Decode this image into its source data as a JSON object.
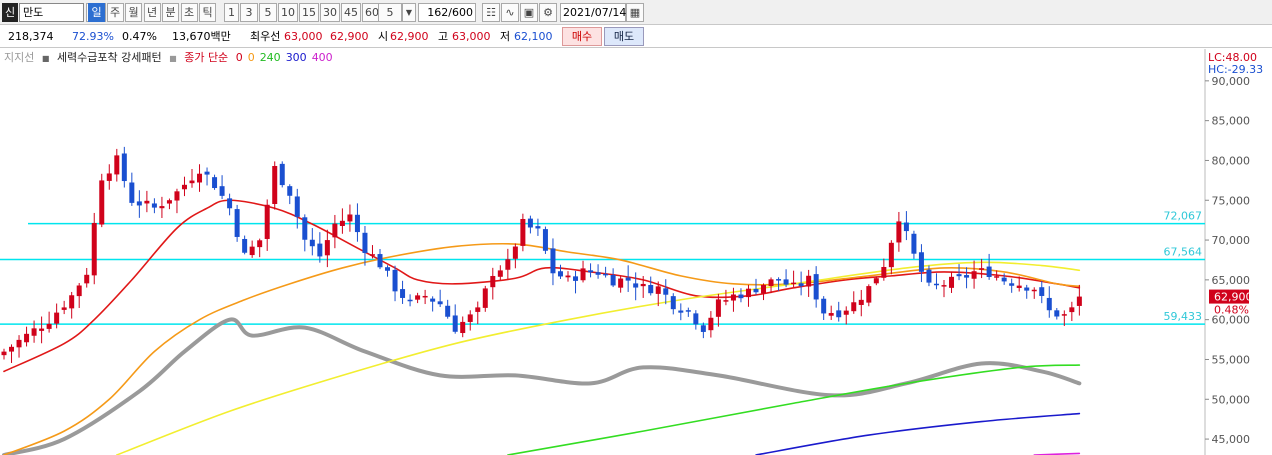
{
  "toolbar": {
    "stock_badge": "신",
    "stock_name": "만도",
    "periods": [
      "일",
      "주",
      "월",
      "년",
      "분",
      "초",
      "틱"
    ],
    "active_period": "일",
    "intervals": [
      "1",
      "3",
      "5",
      "10",
      "15",
      "30",
      "45",
      "60"
    ],
    "interval_select": "5",
    "bar_count": "162/600",
    "date": "2021/07/14"
  },
  "infobar": {
    "volume": "218,374",
    "ratio": "72.93%",
    "change_pct": "0.47%",
    "amount": "13,670백만",
    "best_label": "최우선",
    "best_ask": "63,000",
    "best_bid": "62,900",
    "open_label": "시",
    "open": "62,900",
    "high_label": "고",
    "high": "63,000",
    "low_label": "저",
    "low": "62,100",
    "buy_label": "매수",
    "sell_label": "매도"
  },
  "legend": {
    "item1": "지지선",
    "item2": "세력수급포착 강세패턴",
    "item3": "종가 단순",
    "ma_periods": [
      "0",
      "0",
      "240",
      "300",
      "400"
    ]
  },
  "colors": {
    "up": "#d0021b",
    "down": "#1a4fd0",
    "support": "#00e5ee",
    "ma_red": "#e01818",
    "ma_orange": "#f59a18",
    "ma_yellow": "#f2ee30",
    "ma_green": "#33dd22",
    "ma_blue": "#1a1acc",
    "ma_magenta": "#dd22dd",
    "ma_gray": "#9a9a9a"
  },
  "chart_data": {
    "type": "candlestick",
    "ylim": [
      43000,
      94000
    ],
    "y_ticks": [
      45000,
      50000,
      55000,
      60000,
      65000,
      70000,
      75000,
      80000,
      85000,
      90000
    ],
    "y_tick_labels": [
      "45,000",
      "50,000",
      "55,000",
      "60,000",
      "65,000",
      "70,000",
      "75,000",
      "80,000",
      "85,000",
      "90,000"
    ],
    "lc_label": "LC:48.00",
    "hc_label": "HC:-29.33",
    "support_lines": [
      {
        "value": 72067,
        "label": "72,067"
      },
      {
        "value": 67564,
        "label": "67,564"
      },
      {
        "value": 59433,
        "label": "59,433"
      }
    ],
    "current_price": 62900,
    "current_price_label": "62,900",
    "current_change_label": "0.48%",
    "anchors": [
      [
        0,
        56000
      ],
      [
        3,
        58000
      ],
      [
        6,
        60000
      ],
      [
        9,
        63000
      ],
      [
        11,
        66000
      ],
      [
        13,
        78000
      ],
      [
        15,
        80000
      ],
      [
        17,
        75000
      ],
      [
        20,
        74000
      ],
      [
        23,
        76000
      ],
      [
        26,
        79000
      ],
      [
        28,
        77000
      ],
      [
        30,
        74000
      ],
      [
        32,
        68000
      ],
      [
        34,
        70000
      ],
      [
        36,
        79000
      ],
      [
        38,
        76000
      ],
      [
        40,
        70000
      ],
      [
        42,
        68000
      ],
      [
        44,
        72000
      ],
      [
        46,
        73000
      ],
      [
        48,
        69000
      ],
      [
        50,
        67000
      ],
      [
        52,
        64000
      ],
      [
        54,
        62000
      ],
      [
        56,
        63000
      ],
      [
        58,
        62000
      ],
      [
        60,
        59000
      ],
      [
        63,
        61000
      ],
      [
        65,
        66000
      ],
      [
        67,
        67000
      ],
      [
        69,
        72000
      ],
      [
        71,
        71000
      ],
      [
        73,
        66000
      ],
      [
        75,
        65000
      ],
      [
        77,
        66000
      ],
      [
        79,
        66000
      ],
      [
        81,
        65000
      ],
      [
        83,
        65000
      ],
      [
        85,
        64000
      ],
      [
        87,
        64000
      ],
      [
        89,
        62000
      ],
      [
        91,
        61000
      ],
      [
        93,
        59000
      ],
      [
        95,
        62000
      ],
      [
        97,
        63000
      ],
      [
        99,
        63500
      ],
      [
        101,
        64500
      ],
      [
        103,
        65000
      ],
      [
        105,
        64000
      ],
      [
        107,
        65000
      ],
      [
        109,
        61000
      ],
      [
        111,
        61000
      ],
      [
        113,
        62000
      ],
      [
        115,
        64000
      ],
      [
        117,
        67000
      ],
      [
        119,
        73000
      ],
      [
        121,
        68000
      ],
      [
        123,
        64000
      ],
      [
        125,
        64500
      ],
      [
        127,
        65000
      ],
      [
        129,
        66000
      ],
      [
        131,
        66000
      ],
      [
        133,
        65000
      ],
      [
        135,
        64500
      ],
      [
        137,
        64000
      ],
      [
        139,
        61000
      ],
      [
        141,
        60500
      ],
      [
        143,
        62000
      ]
    ],
    "ma_series": [
      {
        "color_key": "ma_gray",
        "width": 4,
        "points": [
          [
            0,
            43000
          ],
          [
            8,
            45000
          ],
          [
            18,
            51000
          ],
          [
            24,
            56000
          ],
          [
            30,
            60000
          ],
          [
            33,
            58000
          ],
          [
            40,
            59000
          ],
          [
            48,
            56000
          ],
          [
            58,
            53000
          ],
          [
            68,
            53000
          ],
          [
            78,
            52000
          ],
          [
            85,
            54000
          ],
          [
            95,
            53000
          ],
          [
            110,
            50500
          ],
          [
            120,
            52000
          ],
          [
            130,
            54500
          ],
          [
            138,
            53500
          ],
          [
            143,
            52000
          ]
        ]
      },
      {
        "color_key": "ma_red",
        "width": 1.6,
        "points": [
          [
            0,
            53500
          ],
          [
            8,
            57000
          ],
          [
            12,
            60000
          ],
          [
            17,
            65000
          ],
          [
            23,
            71500
          ],
          [
            27,
            74000
          ],
          [
            30,
            75000
          ],
          [
            36,
            74000
          ],
          [
            41,
            72000
          ],
          [
            47,
            69000
          ],
          [
            52,
            66500
          ],
          [
            55,
            65000
          ],
          [
            60,
            64500
          ],
          [
            68,
            65200
          ],
          [
            72,
            66500
          ],
          [
            78,
            66000
          ],
          [
            85,
            65000
          ],
          [
            92,
            63000
          ],
          [
            99,
            63000
          ],
          [
            105,
            64000
          ],
          [
            112,
            65000
          ],
          [
            118,
            65500
          ],
          [
            125,
            66000
          ],
          [
            133,
            65500
          ],
          [
            140,
            64500
          ],
          [
            143,
            64000
          ]
        ]
      },
      {
        "color_key": "ma_orange",
        "width": 1.6,
        "points": [
          [
            0,
            43000
          ],
          [
            8,
            46000
          ],
          [
            14,
            50000
          ],
          [
            20,
            56000
          ],
          [
            26,
            60000
          ],
          [
            32,
            62500
          ],
          [
            38,
            64500
          ],
          [
            45,
            66500
          ],
          [
            52,
            68000
          ],
          [
            60,
            69200
          ],
          [
            68,
            69500
          ],
          [
            75,
            68500
          ],
          [
            82,
            67500
          ],
          [
            90,
            65500
          ],
          [
            97,
            64500
          ],
          [
            105,
            64500
          ],
          [
            115,
            65500
          ],
          [
            125,
            66500
          ],
          [
            133,
            66000
          ],
          [
            140,
            64500
          ],
          [
            143,
            64200
          ]
        ]
      },
      {
        "color_key": "ma_yellow",
        "width": 1.6,
        "points": [
          [
            15,
            43000
          ],
          [
            30,
            48500
          ],
          [
            45,
            53000
          ],
          [
            60,
            57000
          ],
          [
            75,
            60000
          ],
          [
            90,
            62500
          ],
          [
            105,
            64500
          ],
          [
            120,
            66500
          ],
          [
            130,
            67200
          ],
          [
            138,
            66800
          ],
          [
            143,
            66200
          ]
        ]
      },
      {
        "color_key": "ma_green",
        "width": 1.6,
        "points": [
          [
            67,
            43000
          ],
          [
            85,
            46000
          ],
          [
            105,
            49500
          ],
          [
            120,
            52000
          ],
          [
            135,
            54000
          ],
          [
            143,
            54300
          ]
        ]
      },
      {
        "color_key": "ma_blue",
        "width": 1.6,
        "points": [
          [
            100,
            43000
          ],
          [
            115,
            45500
          ],
          [
            130,
            47200
          ],
          [
            143,
            48200
          ]
        ]
      },
      {
        "color_key": "ma_magenta",
        "width": 1.6,
        "points": [
          [
            137,
            43000
          ],
          [
            143,
            43200
          ]
        ]
      }
    ]
  }
}
